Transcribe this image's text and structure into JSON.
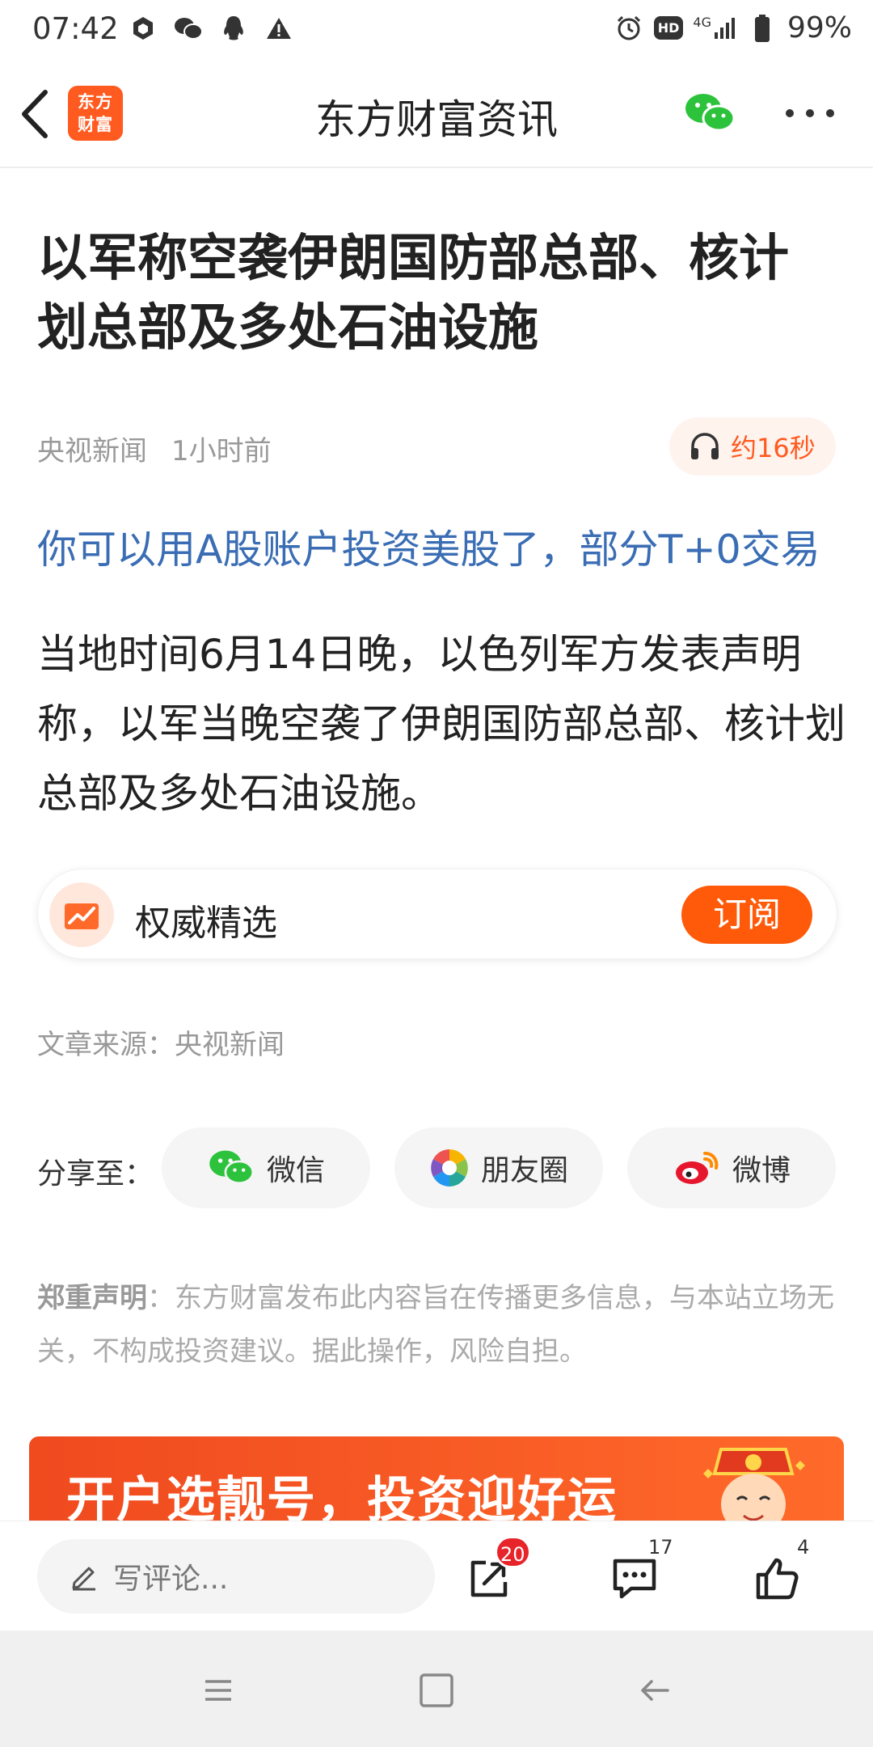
{
  "status_bar": {
    "time": "07:42",
    "network": "4G",
    "battery": "99%",
    "hd_label": "HD"
  },
  "header": {
    "logo_text_line1": "东方",
    "logo_text_line2": "财富",
    "title": "东方财富资讯"
  },
  "article": {
    "title": "以军称空袭伊朗国防部总部、核计划总部及多处石油设施",
    "source_name": "央视新闻",
    "time_ago": "1小时前",
    "listen_label": "约16秒",
    "promo_link": "你可以用A股账户投资美股了，部分T+0交易",
    "body": "当地时间6月14日晚，以色列军方发表声明称，以军当晚空袭了伊朗国防部总部、核计划总部及多处石油设施。",
    "subscription": {
      "label": "权威精选",
      "button": "订阅"
    },
    "source_line": "文章来源：央视新闻"
  },
  "share": {
    "label": "分享至：",
    "options": [
      "微信",
      "朋友圈",
      "微博"
    ]
  },
  "disclaimer": {
    "title": "郑重声明",
    "text": "：东方财富发布此内容旨在传播更多信息，与本站立场无关，不构成投资建议。据此操作，风险自担。"
  },
  "banner": {
    "text": "开户选靓号，投资迎好运"
  },
  "bottom_bar": {
    "comment_placeholder": "写评论...",
    "share_count": "20",
    "comment_count": "17",
    "like_count": "4"
  },
  "colors": {
    "brand": "#ff5a1f",
    "link": "#3a6db4",
    "badge": "#e8242b"
  }
}
